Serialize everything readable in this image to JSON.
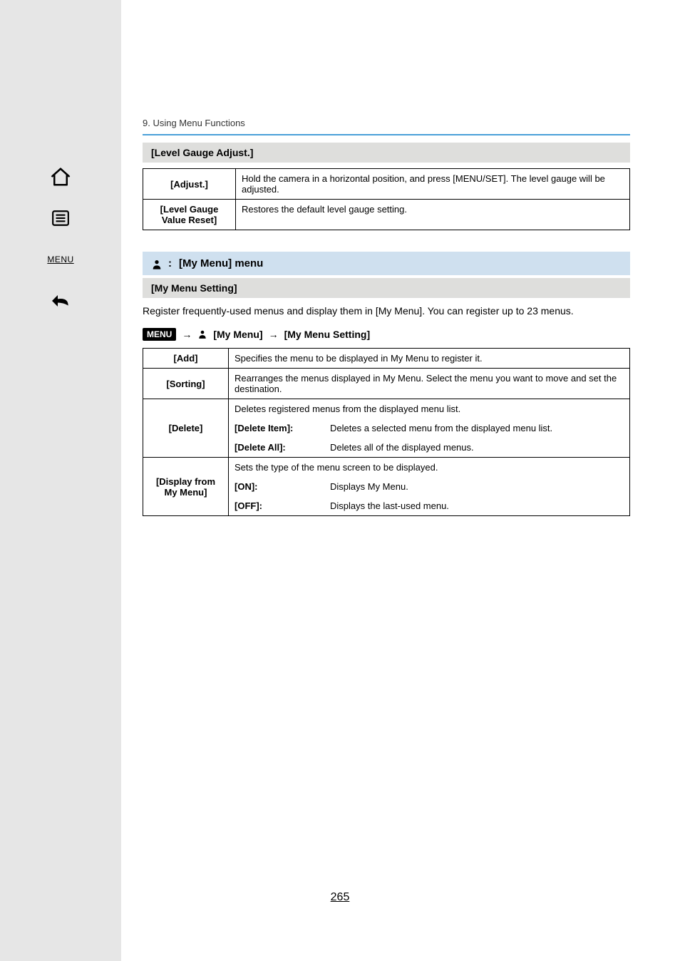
{
  "breadcrumb": "9. Using Menu Functions",
  "sections": {
    "level_gauge": {
      "title": "[Level Gauge Adjust.]",
      "rows": {
        "adjust": {
          "label": "[Adjust.]",
          "desc": "Hold the camera in a horizontal position, and press [MENU/SET]. The level gauge will be adjusted."
        },
        "reset": {
          "label": "[Level Gauge Value Reset]",
          "desc": "Restores the default level gauge setting."
        }
      }
    },
    "my_menu": {
      "header_label": "[My Menu] menu",
      "setting_band": "[My Menu Setting]",
      "intro": "Register frequently-used menus and display them in [My Menu]. You can register up to 23 menus.",
      "path": {
        "menu_badge": "MENU",
        "seg1": "[My Menu]",
        "seg2": "[My Menu Setting]"
      },
      "table": {
        "add": {
          "label": "[Add]",
          "desc": "Specifies the menu to be displayed in My Menu to register it."
        },
        "sorting": {
          "label": "[Sorting]",
          "desc": "Rearranges the menus displayed in My Menu. Select the menu you want to move and set the destination."
        },
        "del": {
          "label": "[Delete]",
          "line1": "Deletes registered menus from the displayed menu list.",
          "item_label": "[Delete Item]:",
          "item_desc": "Deletes a selected menu from the displayed menu list.",
          "all_label": "[Delete All]:",
          "all_desc": "Deletes all of the displayed menus."
        },
        "display": {
          "label": "[Display from My Menu]",
          "line1": "Sets the type of the menu screen to be displayed.",
          "on_label": "[ON]:",
          "on_desc": "Displays My Menu.",
          "off_label": "[OFF]:",
          "off_desc": "Displays the last-used menu."
        }
      }
    }
  },
  "sidebar": {
    "menu_text": "MENU"
  },
  "page_number": "265"
}
